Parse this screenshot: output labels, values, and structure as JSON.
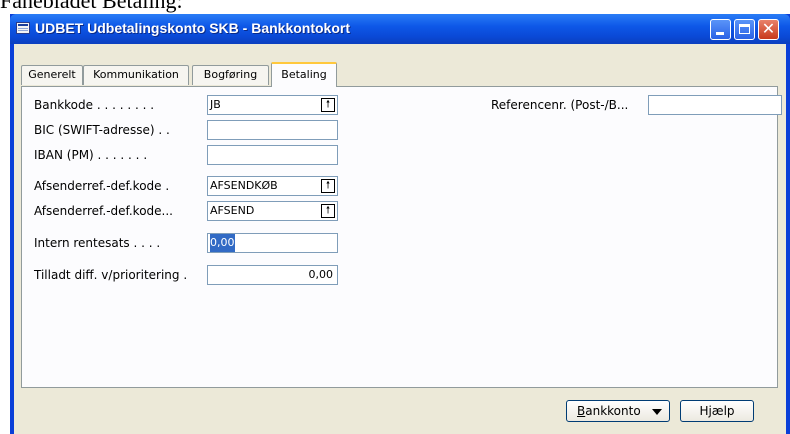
{
  "page_caption": "Fanebladet Betaling:",
  "window": {
    "title": "UDBET Udbetalingskonto SKB - Bankkontokort",
    "icon": "table-window-icon",
    "controls": {
      "minimize": "minimize-icon",
      "maximize": "maximize-icon",
      "close": "close-icon"
    }
  },
  "tabs": [
    {
      "label": "Generelt",
      "active": false
    },
    {
      "label": "Kommunikation",
      "active": false
    },
    {
      "label": "Bogføring",
      "active": false
    },
    {
      "label": "Betaling",
      "active": true
    }
  ],
  "form": {
    "bankkode": {
      "label": "Bankkode . . . . . . . .",
      "value": "JB",
      "has_lookup": true
    },
    "bic": {
      "label": "BIC (SWIFT-adresse) . .",
      "value": ""
    },
    "iban": {
      "label": "IBAN (PM) . . . . . . .",
      "value": ""
    },
    "afsenderref1": {
      "label": "Afsenderref.-def.kode  .",
      "value": "AFSENDKØB",
      "has_lookup": true
    },
    "afsenderref2": {
      "label": "Afsenderref.-def.kode...",
      "value": "AFSEND",
      "has_lookup": true
    },
    "intern_rentesats": {
      "label": "Intern rentesats  . . . .",
      "value": "0,00",
      "selected": true
    },
    "tilladt_diff": {
      "label": "Tilladt diff. v/prioritering .",
      "value": "0,00"
    },
    "referencenr": {
      "label": "Referencenr. (Post-/B...",
      "value": ""
    }
  },
  "buttons": {
    "bankkonto": {
      "label_hotkey": "B",
      "label_rest": "ankkonto"
    },
    "hjaelp": {
      "label": "Hjælp"
    }
  },
  "colors": {
    "title_bar": "#0e58e8",
    "client_bg": "#ece9d8",
    "selection": "#316ac5",
    "active_tab_accent": "#ffc83c"
  }
}
